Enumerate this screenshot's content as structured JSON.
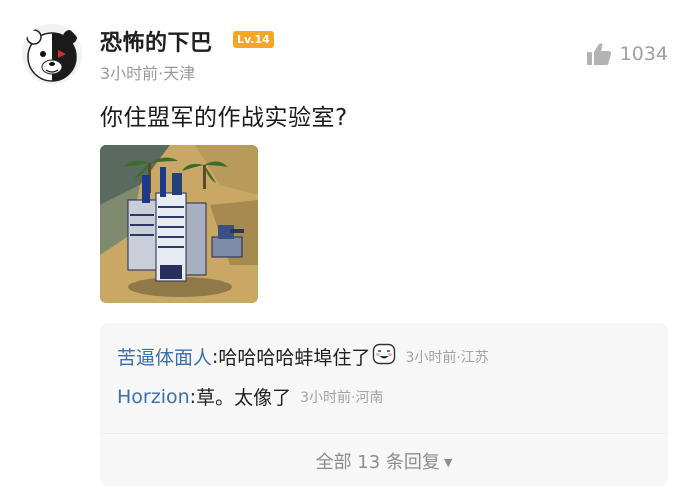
{
  "comment": {
    "username": "恐怖的下巴",
    "level": "Lv.14",
    "meta": "3小时前·天津",
    "like_count": "1034",
    "text": "你住盟军的作战实验室?"
  },
  "replies": [
    {
      "name": "苦逼体面人",
      "sep": ": ",
      "text": "哈哈哈哈蚌埠住了",
      "time": "3小时前·江苏"
    },
    {
      "name": "Horzion",
      "sep": ": ",
      "text": "草。太像了",
      "time": "3小时前·河南"
    }
  ],
  "all_replies_label": "全部 13 条回复",
  "colors": {
    "accent_blue": "#3d6fb0",
    "level_badge": "#f5a623",
    "muted": "#9a9a9a",
    "reply_bg": "#f7f7f8"
  },
  "icons": {
    "like": "thumbs-up-icon",
    "emoji": "grin-emoji-icon",
    "expand": "caret-down-icon"
  }
}
